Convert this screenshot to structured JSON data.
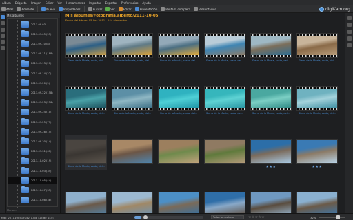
{
  "menu": [
    "Álbum",
    "Etiqueta",
    "Imagen",
    "Editar",
    "Ver",
    "Herramientas",
    "Importar",
    "Exportar",
    "Preferencias",
    "Ayuda"
  ],
  "toolbar": {
    "back": "Atrás",
    "forward": "",
    "up": "Adelante",
    "items": [
      {
        "label": "Nuevo",
        "icon": "folder-new-icon"
      },
      {
        "label": "Propiedades",
        "icon": "properties-icon"
      },
      {
        "label": "Buscar",
        "icon": "search-icon"
      },
      {
        "label": "Ver",
        "icon": "view-icon"
      },
      {
        "label": "Editar",
        "icon": "edit-icon"
      },
      {
        "label": "Presentación",
        "icon": "slideshow-icon"
      },
      {
        "label": "Pantalla completa",
        "icon": "fullscreen-icon"
      },
      {
        "label": "Presentación",
        "icon": "presentation-icon"
      }
    ]
  },
  "app_logo": "digiKam.org",
  "album_panel": {
    "header": "Mis álbumes",
    "folders": [
      "2011-09-03",
      "2011-09-05 (55)",
      "2011-09-10 (8)",
      "2011-09-11 (188)",
      "2011-09-13 (21)",
      "2011-09-14 (22)",
      "2011-09-20 (5)",
      "2011-09-22 (158)",
      "2011-09-23 (256)",
      "2011-09-24 (10)",
      "2011-09-25 (73)",
      "2011-09-28 (15)",
      "2011-09-30 (14)",
      "2011-09-31 (61)",
      "2011-10-02 (19)",
      "2011-10-03 (34)",
      "2011-10-05 (44)",
      "2011-10-07 (35)",
      "2011-10-08 (38)"
    ],
    "selected_index": 16,
    "footer": "Menos..."
  },
  "main": {
    "title": "Mis álbumes/Fotografía,alberto/2011-10-05",
    "subtitle": "Fecha del álbum: 05 Oct 2011 - 144 elementos",
    "caption_text": "Sierra de la Muela, costa, del",
    "rows": [
      {
        "thumbs": [
          {
            "colors": [
              "#7b8a95",
              "#2c5f86",
              "#c99e4a"
            ],
            "caption": "Sierra de la Muela, costa, del...",
            "selected": false
          },
          {
            "colors": [
              "#9fb4c0",
              "#5f7a86",
              "#d9a23a"
            ],
            "caption": "Sierra de la Muela, costa, del...",
            "selected": false
          },
          {
            "colors": [
              "#93a9b8",
              "#4a6e82",
              "#e0ab3f"
            ],
            "caption": "Sierra de la Muela, costa, del...",
            "selected": false
          },
          {
            "colors": [
              "#b9ccd8",
              "#3f85b3",
              "#8c7d6a"
            ],
            "caption": "Sierra de la Muela, costa, del...",
            "selected": false
          },
          {
            "colors": [
              "#9eb8c4",
              "#7b6e5a",
              "#2f6f94"
            ],
            "caption": "Sierra de la Muela, costa, del...",
            "selected": false
          },
          {
            "colors": [
              "#c8b49a",
              "#8a6a48",
              "#b99d7a"
            ],
            "caption": "Sierra de la Muela, costa, del...",
            "selected": false
          }
        ]
      },
      {
        "thumbs": [
          {
            "colors": [
              "#2a6e7c",
              "#4aa2a8",
              "#1b4f5c"
            ],
            "caption": "Sierra de la Muela, costa, del...",
            "selected": false
          },
          {
            "colors": [
              "#5c8fa6",
              "#8fb7c4",
              "#3c6f86"
            ],
            "caption": "Sierra de la Muela, costa, del...",
            "selected": false
          },
          {
            "colors": [
              "#2fb2c0",
              "#4fd0d6",
              "#1f95a6"
            ],
            "caption": "Sierra de la Muela, costa, del...",
            "selected": false
          },
          {
            "colors": [
              "#36b6bc",
              "#5fd3d4",
              "#2996a3"
            ],
            "caption": "Sierra de la Muela, costa, del...",
            "selected": false
          },
          {
            "colors": [
              "#4aa8a0",
              "#7ccfc4",
              "#2e8a86"
            ],
            "caption": "Sierra de la Muela, costa, del...",
            "selected": false
          },
          {
            "colors": [
              "#6fb2c0",
              "#a5d3dc",
              "#3f8fa3"
            ],
            "caption": "Sierra de la Muela, costa, del...",
            "selected": false
          }
        ]
      },
      {
        "thumbs": [
          {
            "colors": [
              "#4a4540",
              "#3a3632",
              "#5a534b"
            ],
            "caption": "Sierra de la Muela, costa, del...",
            "selected": true,
            "stars": ""
          },
          {
            "colors": [
              "#a88866",
              "#6c5646",
              "#4f84ad"
            ],
            "caption": "",
            "selected": false,
            "stars": ""
          },
          {
            "colors": [
              "#9c7f5e",
              "#6f8a4c",
              "#c0a27c"
            ],
            "caption": "",
            "selected": false,
            "stars": ""
          },
          {
            "colors": [
              "#8f7a62",
              "#5f7a3c",
              "#b39a7a"
            ],
            "caption": "",
            "selected": false,
            "stars": ""
          },
          {
            "colors": [
              "#2c6ea8",
              "#7b6b5c",
              "#a8c8e2"
            ],
            "caption": "",
            "selected": false,
            "stars": "★★★"
          },
          {
            "colors": [
              "#3a7ab4",
              "#8b7a66",
              "#b8d2e6"
            ],
            "caption": "",
            "selected": false,
            "stars": "★★★"
          }
        ]
      },
      {
        "thumbs": [
          {
            "colors": [
              "#8fb0cc",
              "#6b5a4a",
              "#4f84ad"
            ],
            "caption": "",
            "selected": false
          },
          {
            "colors": [
              "#9cb8d0",
              "#a08866",
              "#6a93b8"
            ],
            "caption": "",
            "selected": false
          },
          {
            "colors": [
              "#4c8fc6",
              "#7a6a58",
              "#3270a6"
            ],
            "caption": "",
            "selected": false
          },
          {
            "colors": [
              "#2f6ea8",
              "#88a8c8",
              "#5a4a3c"
            ],
            "caption": "",
            "selected": false
          },
          {
            "colors": [
              "#6f98c0",
              "#5a4c3e",
              "#98b8d4"
            ],
            "caption": "",
            "selected": false
          },
          {
            "colors": [
              "#8ab0d0",
              "#6b5a48",
              "#3a78b0"
            ],
            "caption": "",
            "selected": false
          }
        ]
      }
    ]
  },
  "status": {
    "file": "foto_2011100517052_1.jpg (15 de 144)",
    "progress": 0.1,
    "filter": "Todos los archivos",
    "rating_stars": "☆☆☆☆☆",
    "zoom": "32%"
  }
}
